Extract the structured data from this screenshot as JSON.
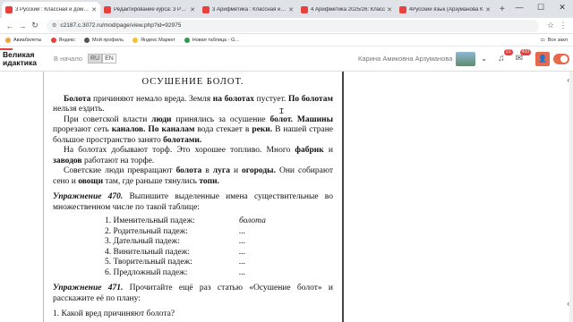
{
  "tabs": [
    {
      "title": "3 Русский : Классная и домаш",
      "active": true
    },
    {
      "title": "Редактирование курса: 3 Русс",
      "active": false
    },
    {
      "title": "3 Арифметика : Классная и до",
      "active": false
    },
    {
      "title": "4 Арифметика 2025/26: Класс",
      "active": false
    },
    {
      "title": "4Русский язык (Арзуманова К",
      "active": false
    }
  ],
  "browser": {
    "url": "c2187.c.3072.ru/mod/page/view.php?id=92975",
    "back": "←",
    "forward": "→",
    "reload": "↻",
    "new_tab": "+",
    "minimize": "—",
    "maximize": "☐",
    "close": "✕",
    "star": "☆",
    "menu": "⋮"
  },
  "bookmarks": {
    "items": [
      {
        "label": "Авиабилеты",
        "color": "#f2a33a"
      },
      {
        "label": "Яндекс",
        "color": "#e8413d"
      },
      {
        "label": "Мой профиль",
        "color": "#555555"
      },
      {
        "label": "Яндекс Маркет",
        "color": "#f2c230"
      },
      {
        "label": "Новая таблица - G...",
        "color": "#2a9d4a"
      }
    ],
    "all_label": "Все закл"
  },
  "site": {
    "logo_line1": "Великая",
    "logo_line2": "идактика",
    "home": "В начало",
    "lang_ru": "RU",
    "lang_en": "EN",
    "user_name": "Карина Амиковна Арзуманова",
    "chevron": "⌄",
    "bell_count": "21",
    "msg_count": "410"
  },
  "doc": {
    "title": "ОСУШЕНИЕ БОЛОТ.",
    "p1": [
      {
        "t": "Болота",
        "b": true
      },
      {
        "t": " причиняют немало вреда. Земля "
      },
      {
        "t": "на болотах",
        "b": true
      },
      {
        "t": " пустует. "
      },
      {
        "t": "По болотам",
        "b": true
      },
      {
        "t": " нельзя ездить."
      }
    ],
    "p2": [
      {
        "t": "При советской власти "
      },
      {
        "t": "люди",
        "b": true
      },
      {
        "t": " принялись за осушение "
      },
      {
        "t": "болот.",
        "b": true
      },
      {
        "t": " "
      },
      {
        "t": "Машины",
        "b": true
      },
      {
        "t": " прорезают сеть "
      },
      {
        "t": "каналов.",
        "b": true
      },
      {
        "t": " "
      },
      {
        "t": "По каналам",
        "b": true
      },
      {
        "t": " вода стекает в "
      },
      {
        "t": "реки.",
        "b": true
      },
      {
        "t": " В нашей стране большое пространство занято "
      },
      {
        "t": "болотами.",
        "b": true
      }
    ],
    "p3": [
      {
        "t": "На болотах добывают торф. Это хорошее топливо. Много "
      },
      {
        "t": "фабрик",
        "b": true
      },
      {
        "t": " и "
      },
      {
        "t": "заводов",
        "b": true
      },
      {
        "t": " работают на торфе."
      }
    ],
    "p4": [
      {
        "t": "Советские люди превращают "
      },
      {
        "t": "болота",
        "b": true
      },
      {
        "t": " в "
      },
      {
        "t": "луга",
        "b": true
      },
      {
        "t": " и "
      },
      {
        "t": "огороды.",
        "b": true
      },
      {
        "t": " Они собирают сено и "
      },
      {
        "t": "овощи",
        "b": true
      },
      {
        "t": " там, где раньше тянулись "
      },
      {
        "t": "топи.",
        "b": true
      }
    ],
    "ex470_head": "Упражнение 470.",
    "ex470_text": " Выпишите выделенные имена существительные во множественном числе по такой таблице:",
    "cases": [
      {
        "label": "1. Именительный падеж:",
        "value": "болота"
      },
      {
        "label": "2. Родительный падеж:",
        "value": "..."
      },
      {
        "label": "3. Дательный падеж:",
        "value": "..."
      },
      {
        "label": "4. Винительный падеж:",
        "value": "..."
      },
      {
        "label": "5. Творительный падеж:",
        "value": "..."
      },
      {
        "label": "6. Предложный падеж:",
        "value": "..."
      }
    ],
    "ex471_head": "Упражнение 471.",
    "ex471_text": " Прочитайте ещё раз статью «Осушение болот» и расскажите её по плану:",
    "q1": "1. Какой вред причиняют болота?"
  }
}
